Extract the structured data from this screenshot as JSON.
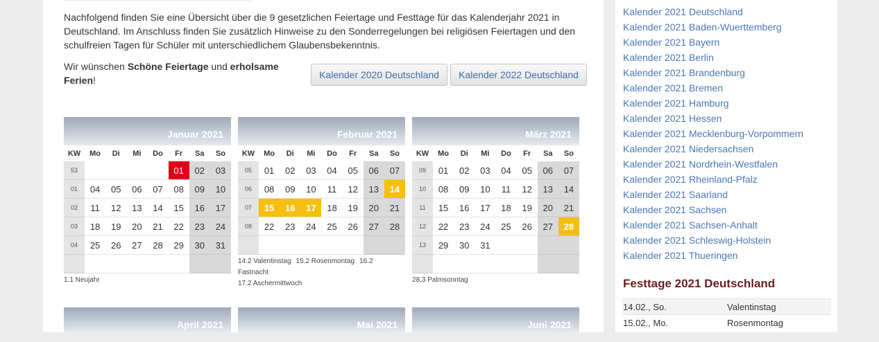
{
  "intro_text": "Nachfolgend finden Sie eine Übersicht über die 9 gesetzlichen Feiertage und Festtage für das Kalenderjahr 2021 in Deutschland. Im Anschluss finden Sie zusätzlich Hinweise zu den Sonderregelungen bei religiösen Feiertagen und den schulfreien Tagen für Schüler mit unterschiedlichem Glaubensbekenntnis.",
  "wish": {
    "prefix": "Wir wünschen ",
    "bold1": "Schöne Feiertage",
    "mid": " und ",
    "bold2": "erholsame Ferien",
    "suffix": "!"
  },
  "buttons": {
    "prev": "Kalender 2020 Deutschland",
    "next": "Kalender 2022 Deutschland"
  },
  "weekday_headers": [
    "KW",
    "Mo",
    "Di",
    "Mi",
    "Do",
    "Fr",
    "Sa",
    "So"
  ],
  "colors": {
    "holiday": "#e2001a",
    "festival": "#f5bf0f",
    "link": "#4a77b4",
    "sidebar_title": "#6b1e1e"
  },
  "months": [
    {
      "name": "Januar 2021",
      "rows": [
        {
          "kw": "53",
          "days": [
            "",
            "",
            "",
            "",
            "01",
            "02",
            "03"
          ],
          "hol": [
            4
          ]
        },
        {
          "kw": "01",
          "days": [
            "04",
            "05",
            "06",
            "07",
            "08",
            "09",
            "10"
          ]
        },
        {
          "kw": "02",
          "days": [
            "11",
            "12",
            "13",
            "14",
            "15",
            "16",
            "17"
          ]
        },
        {
          "kw": "03",
          "days": [
            "18",
            "19",
            "20",
            "21",
            "22",
            "23",
            "24"
          ]
        },
        {
          "kw": "04",
          "days": [
            "25",
            "26",
            "27",
            "28",
            "29",
            "30",
            "31"
          ]
        },
        {
          "kw": "",
          "days": [
            "",
            "",
            "",
            "",
            "",
            "",
            ""
          ]
        }
      ],
      "notes": [
        "1.1 Neujahr"
      ]
    },
    {
      "name": "Februar 2021",
      "rows": [
        {
          "kw": "05",
          "days": [
            "01",
            "02",
            "03",
            "04",
            "05",
            "06",
            "07"
          ]
        },
        {
          "kw": "06",
          "days": [
            "08",
            "09",
            "10",
            "11",
            "12",
            "13",
            "14"
          ],
          "fest": [
            6
          ]
        },
        {
          "kw": "07",
          "days": [
            "15",
            "16",
            "17",
            "18",
            "19",
            "20",
            "21"
          ],
          "fest": [
            0,
            1,
            2
          ]
        },
        {
          "kw": "08",
          "days": [
            "22",
            "23",
            "24",
            "25",
            "26",
            "27",
            "28"
          ]
        },
        {
          "kw": "",
          "days": [
            "",
            "",
            "",
            "",
            "",
            "",
            ""
          ]
        }
      ],
      "notes": [
        "14.2 Valentinstag",
        "15.2 Rosenmontag",
        "16.2 Fastnacht",
        "17.2 Aschermittwoch"
      ]
    },
    {
      "name": "März 2021",
      "rows": [
        {
          "kw": "09",
          "days": [
            "01",
            "02",
            "03",
            "04",
            "05",
            "06",
            "07"
          ]
        },
        {
          "kw": "10",
          "days": [
            "08",
            "09",
            "10",
            "11",
            "12",
            "13",
            "14"
          ]
        },
        {
          "kw": "11",
          "days": [
            "15",
            "16",
            "17",
            "18",
            "19",
            "20",
            "21"
          ]
        },
        {
          "kw": "12",
          "days": [
            "22",
            "23",
            "24",
            "25",
            "26",
            "27",
            "28"
          ],
          "fest": [
            6
          ]
        },
        {
          "kw": "13",
          "days": [
            "29",
            "30",
            "31",
            "",
            "",
            "",
            ""
          ]
        },
        {
          "kw": "",
          "days": [
            "",
            "",
            "",
            "",
            "",
            "",
            ""
          ]
        }
      ],
      "notes": [
        "28.3 Palmsonntag"
      ]
    }
  ],
  "next_months": [
    "April 2021",
    "Mai 2021",
    "Juni 2021"
  ],
  "sidebar": {
    "links": [
      "Kalender 2021 Deutschland",
      "Kalender 2021 Baden-Wuerttemberg",
      "Kalender 2021 Bayern",
      "Kalender 2021 Berlin",
      "Kalender 2021 Brandenburg",
      "Kalender 2021 Bremen",
      "Kalender 2021 Hamburg",
      "Kalender 2021 Hessen",
      "Kalender 2021 Mecklenburg-Vorpommern",
      "Kalender 2021 Niedersachsen",
      "Kalender 2021 Nordrhein-Westfalen",
      "Kalender 2021 Rheinland-Pfalz",
      "Kalender 2021 Saarland",
      "Kalender 2021 Sachsen",
      "Kalender 2021 Sachsen-Anhalt",
      "Kalender 2021 Schleswig-Holstein",
      "Kalender 2021 Thueringen"
    ],
    "title": "Festtage 2021 Deutschland",
    "festtage": [
      {
        "date": "14.02., So.",
        "name": "Valentinstag"
      },
      {
        "date": "15.02., Mo.",
        "name": "Rosenmontag"
      }
    ]
  }
}
